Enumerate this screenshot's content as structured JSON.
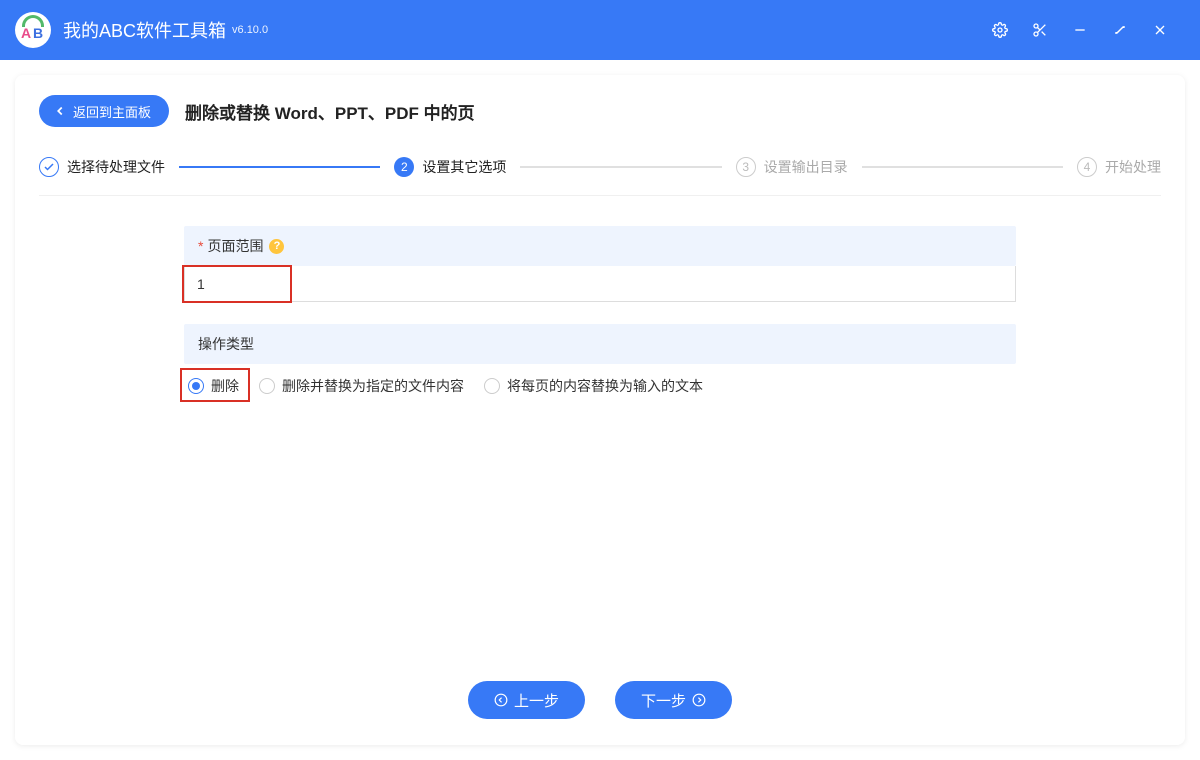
{
  "titlebar": {
    "app_name": "我的ABC软件工具箱",
    "version": "v6.10.0"
  },
  "header": {
    "back_label": "返回到主面板",
    "page_title": "删除或替换 Word、PPT、PDF 中的页"
  },
  "stepper": {
    "steps": [
      {
        "num": "1",
        "label": "选择待处理文件",
        "state": "done"
      },
      {
        "num": "2",
        "label": "设置其它选项",
        "state": "active"
      },
      {
        "num": "3",
        "label": "设置输出目录",
        "state": "pending"
      },
      {
        "num": "4",
        "label": "开始处理",
        "state": "pending"
      }
    ]
  },
  "form": {
    "page_range": {
      "label": "页面范围",
      "required_star": "*",
      "help_mark": "?",
      "value": "1"
    },
    "operation_type": {
      "label": "操作类型",
      "options": [
        {
          "label": "删除",
          "checked": true
        },
        {
          "label": "删除并替换为指定的文件内容",
          "checked": false
        },
        {
          "label": "将每页的内容替换为输入的文本",
          "checked": false
        }
      ]
    }
  },
  "footer": {
    "prev": "上一步",
    "next": "下一步"
  }
}
